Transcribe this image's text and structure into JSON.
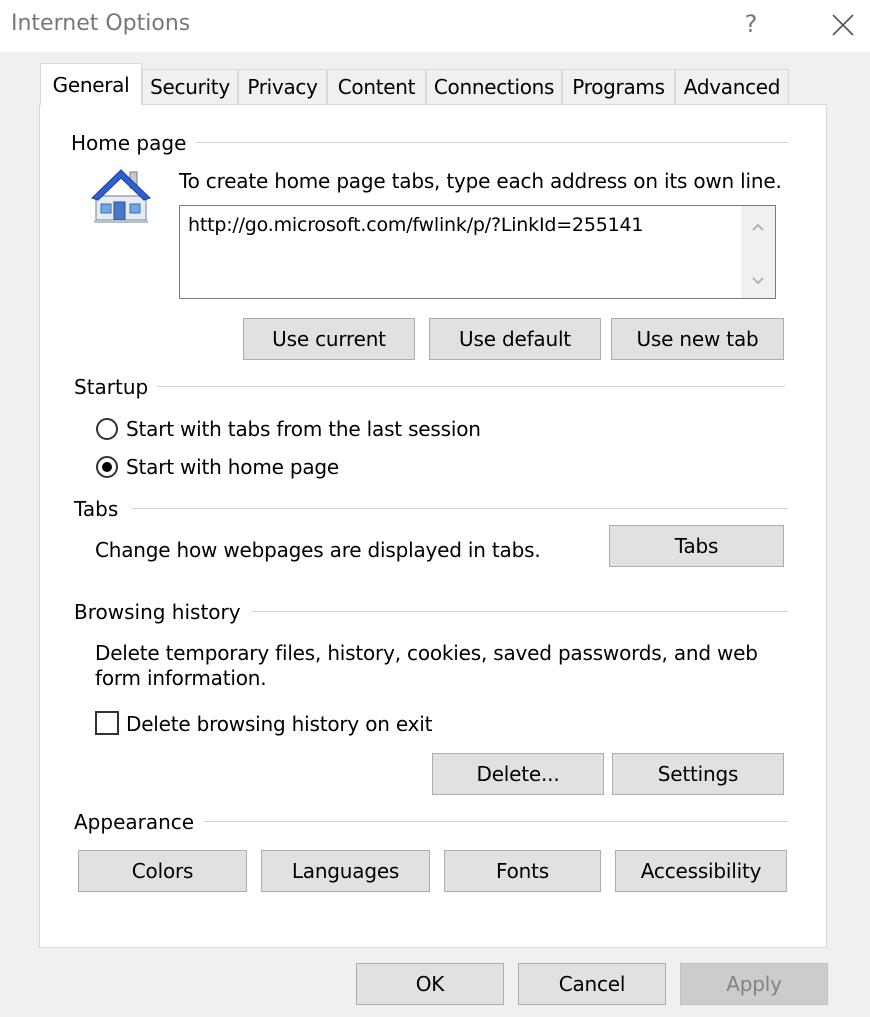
{
  "window": {
    "title": "Internet Options",
    "help_label": "?"
  },
  "tabs": [
    {
      "label": "General",
      "active": true
    },
    {
      "label": "Security",
      "active": false
    },
    {
      "label": "Privacy",
      "active": false
    },
    {
      "label": "Content",
      "active": false
    },
    {
      "label": "Connections",
      "active": false
    },
    {
      "label": "Programs",
      "active": false
    },
    {
      "label": "Advanced",
      "active": false
    }
  ],
  "home_page": {
    "section_label": "Home page",
    "instruction": "To create home page tabs, type each address on its own line.",
    "url_value": "http://go.microsoft.com/fwlink/p/?LinkId=255141",
    "use_current_label": "Use current",
    "use_default_label": "Use default",
    "use_new_tab_label": "Use new tab",
    "icon": "house-icon"
  },
  "startup": {
    "section_label": "Startup",
    "options": [
      {
        "label": "Start with tabs from the last session",
        "selected": false
      },
      {
        "label": "Start with home page",
        "selected": true
      }
    ]
  },
  "tabs_section": {
    "section_label": "Tabs",
    "description": "Change how webpages are displayed in tabs.",
    "button_label": "Tabs"
  },
  "browsing_history": {
    "section_label": "Browsing history",
    "description_line1": "Delete temporary files, history, cookies, saved passwords, and web",
    "description_line2": "form information.",
    "delete_on_exit_label": "Delete browsing history on exit",
    "delete_on_exit_checked": false,
    "delete_label": "Delete...",
    "settings_label": "Settings"
  },
  "appearance": {
    "section_label": "Appearance",
    "colors_label": "Colors",
    "languages_label": "Languages",
    "fonts_label": "Fonts",
    "accessibility_label": "Accessibility"
  },
  "footer": {
    "ok_label": "OK",
    "cancel_label": "Cancel",
    "apply_label": "Apply"
  },
  "colors": {
    "house_roof": "#2f5fd6",
    "house_wall": "#e8eef6"
  }
}
